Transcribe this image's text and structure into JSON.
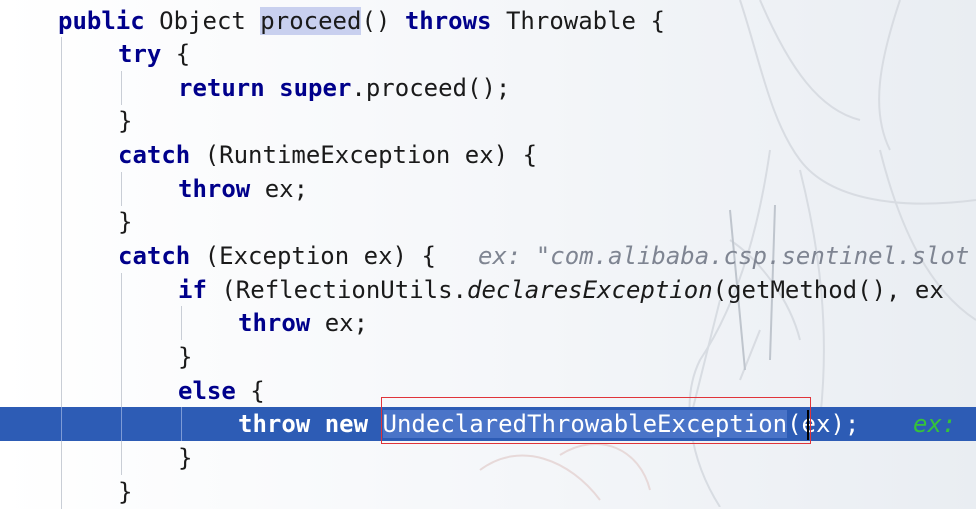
{
  "lines": {
    "l1": {
      "public": "public",
      "type": " Object ",
      "method": "proceed",
      "after": "() ",
      "throws": "throws",
      "tail": " Throwable {"
    },
    "l2": {
      "try": "try",
      "tail": " {"
    },
    "l3": {
      "return": "return",
      "super": "super",
      "tail": ".proceed();"
    },
    "l4": {
      "brace": "}"
    },
    "l5": {
      "catch": "catch",
      "tail": " (RuntimeException ex) {"
    },
    "l6": {
      "throw": "throw",
      "tail": " ex;"
    },
    "l7": {
      "brace": "}"
    },
    "l8": {
      "catch": "catch",
      "tail": " (Exception ex) {",
      "hint": "ex: \"com.alibaba.csp.sentinel.slot"
    },
    "l9": {
      "if": "if",
      "pre": " (ReflectionUtils.",
      "method": "declaresException",
      "tail": "(getMethod(), ex"
    },
    "l10": {
      "throw": "throw",
      "tail": " ex;"
    },
    "l11": {
      "brace": "}"
    },
    "l12": {
      "else": "else",
      "tail": " {"
    },
    "l13": {
      "throw": "throw",
      "new": "new",
      "selected": "UndeclaredThrowableException",
      "tail": "(ex);",
      "hint": "ex:"
    },
    "l14": {
      "brace": "}"
    },
    "l15": {
      "brace": "}"
    }
  },
  "colors": {
    "keyword": "#00008b",
    "current_line": "#2d5cb5",
    "selection_border": "#e0343a",
    "inline_hint": "#7f8592",
    "inline_hint_current": "#35c23a"
  }
}
